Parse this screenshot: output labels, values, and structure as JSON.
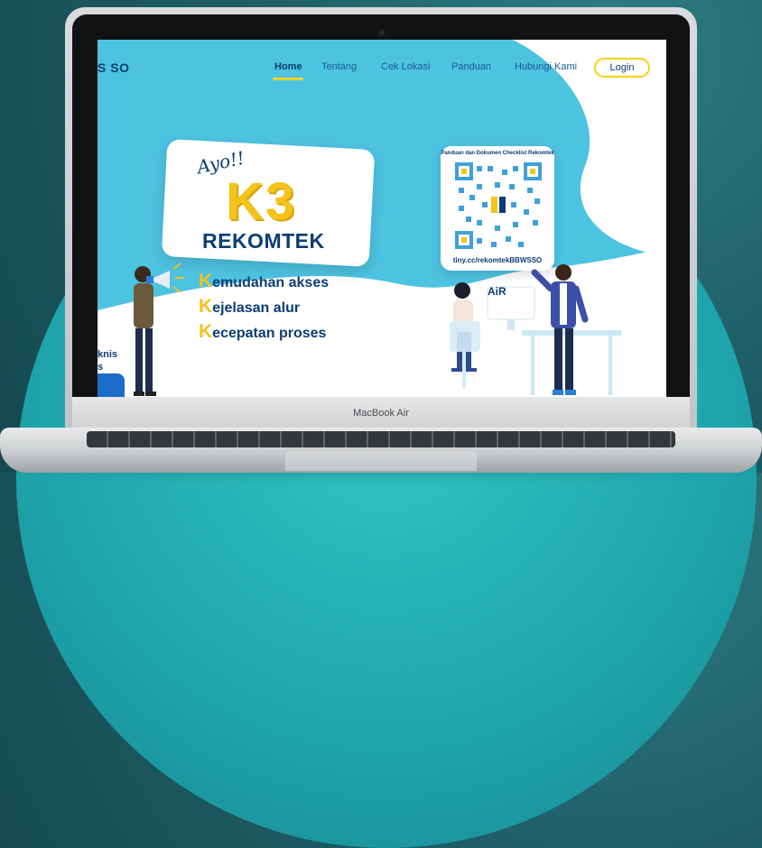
{
  "laptop": {
    "model_label": "MacBook Air"
  },
  "site": {
    "brand": "S SO",
    "nav": {
      "items": [
        "Home",
        "Tentang",
        "Cek Lokasi",
        "Panduan",
        "Hubungi Kami"
      ],
      "active": "Home",
      "login_label": "Login"
    },
    "hero": {
      "ayo": "Ayo!!",
      "k3": "K3",
      "rekomtek": "REKOMTEK",
      "features": [
        {
          "initial": "K",
          "rest": "emudahan akses"
        },
        {
          "initial": "K",
          "rest": "ejelasan alur"
        },
        {
          "initial": "K",
          "rest": "ecepatan proses"
        }
      ]
    },
    "qr": {
      "title": "Panduan dan Dokumen Checklist Rekomtek",
      "url": "tiny.cc/rekomtekBBWSSO"
    },
    "left_partial_text": [
      "knis",
      "s"
    ],
    "air_logo": "AiR"
  },
  "colors": {
    "primary": "#0c3d73",
    "accent": "#f4c31c",
    "screen_bg": "#4dc3e2",
    "nav_text": "#1b5b8f"
  },
  "icons": [
    "megaphone-icon",
    "qr-code-icon",
    "pu-logo-icon",
    "air-logo-icon"
  ]
}
